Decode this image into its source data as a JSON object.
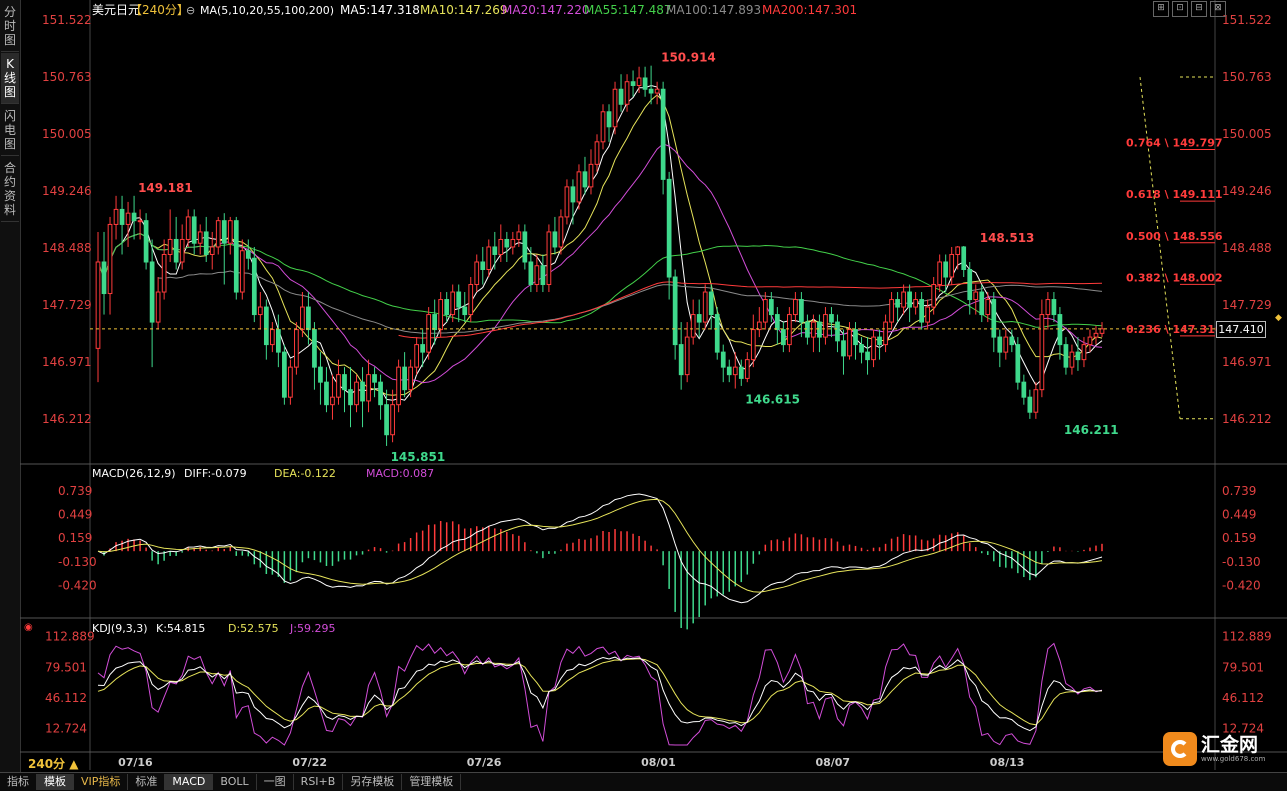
{
  "app": {
    "left_tabs": [
      "分时图",
      "K线图",
      "闪电图",
      "合约资料"
    ],
    "active_left_tab": 1,
    "window_buttons": [
      "⊞",
      "⊡",
      "⊟",
      "⊠"
    ],
    "bottom_tabs": [
      "指标",
      "模板",
      "VIP指标",
      "标准",
      "MACD",
      "BOLL",
      "一图",
      "RSI+B",
      "另存模板",
      "管理模板"
    ],
    "active_bottom_tabs": [
      1,
      4
    ],
    "vip_tab": 2,
    "period_label": "240分 ▲",
    "logo_text": "汇金网",
    "logo_url": "www.gold678.com",
    "current_price_tag": "147.410"
  },
  "chart_data": [
    {
      "type": "candlestick",
      "instrument": "美元日元",
      "period": "【240分】",
      "ma_legend": {
        "header": "MA(5,10,20,55,100,200)",
        "items": [
          {
            "label": "MA5:147.318",
            "color": "#ffffff"
          },
          {
            "label": "MA10:147.269",
            "color": "#e6e35a"
          },
          {
            "label": "MA20:147.220",
            "color": "#d24dd8"
          },
          {
            "label": "MA55:147.487",
            "color": "#43d04a"
          },
          {
            "label": "MA100:147.893",
            "color": "#8a8a8a"
          },
          {
            "label": "MA200:147.301",
            "color": "#ff3b3b"
          }
        ]
      },
      "y_ticks": [
        "151.522",
        "150.763",
        "150.005",
        "149.246",
        "148.488",
        "147.729",
        "146.971",
        "146.212"
      ],
      "ylim": [
        145.85,
        151.522
      ],
      "x_ticks": [
        {
          "label": "07/16",
          "bar": 6
        },
        {
          "label": "07/22",
          "bar": 35
        },
        {
          "label": "07/26",
          "bar": 64
        },
        {
          "label": "08/01",
          "bar": 93
        },
        {
          "label": "08/07",
          "bar": 122
        },
        {
          "label": "08/13",
          "bar": 151
        }
      ],
      "annotations": [
        {
          "text": "149.181",
          "bar": 6,
          "value": 149.181,
          "kind": "high"
        },
        {
          "text": "145.851",
          "bar": 48,
          "value": 145.851,
          "kind": "low"
        },
        {
          "text": "150.914",
          "bar": 93,
          "value": 150.914,
          "kind": "high"
        },
        {
          "text": "146.615",
          "bar": 107,
          "value": 146.615,
          "kind": "low"
        },
        {
          "text": "148.513",
          "bar": 146,
          "value": 148.513,
          "kind": "high"
        },
        {
          "text": "146.211",
          "bar": 160,
          "value": 146.211,
          "kind": "low"
        }
      ],
      "fibonacci": [
        {
          "label": "0.764 \\ 149.797",
          "value": 149.797
        },
        {
          "label": "0.618 \\ 149.111",
          "value": 149.111
        },
        {
          "label": "0.500 \\ 148.556",
          "value": 148.556
        },
        {
          "label": "0.382 \\ 148.002",
          "value": 148.002
        },
        {
          "label": "0.236 \\ 147.316",
          "value": 147.316
        }
      ],
      "fib_range": {
        "top": 150.763,
        "bottom": 146.212
      },
      "current_price": 147.41,
      "candles": [
        [
          147.15,
          148.3,
          148.7,
          146.7
        ],
        [
          148.3,
          147.88,
          148.7,
          147.6
        ],
        [
          147.88,
          148.8,
          148.9,
          147.6
        ],
        [
          148.8,
          149.0,
          149.181,
          148.6
        ],
        [
          149.0,
          148.8,
          149.181,
          148.4
        ],
        [
          148.8,
          148.95,
          149.1,
          148.5
        ],
        [
          148.95,
          148.85,
          149.181,
          148.6
        ],
        [
          148.85,
          148.85,
          149.0,
          148.6
        ],
        [
          148.85,
          148.3,
          148.95,
          148.2
        ],
        [
          148.3,
          147.5,
          148.6,
          146.9
        ],
        [
          147.5,
          147.9,
          148.1,
          147.4
        ],
        [
          147.9,
          148.4,
          148.6,
          147.8
        ],
        [
          148.4,
          148.6,
          149.0,
          148.3
        ],
        [
          148.6,
          148.3,
          148.9,
          148.2
        ],
        [
          148.3,
          148.6,
          148.8,
          148.2
        ],
        [
          148.6,
          148.9,
          149.0,
          148.5
        ],
        [
          148.9,
          148.55,
          149.0,
          148.4
        ],
        [
          148.55,
          148.7,
          148.8,
          148.4
        ],
        [
          148.7,
          148.4,
          148.9,
          148.3
        ],
        [
          148.4,
          148.5,
          148.7,
          148.2
        ],
        [
          148.5,
          148.85,
          148.9,
          148.4
        ],
        [
          148.85,
          148.55,
          148.95,
          148.0
        ],
        [
          148.55,
          148.85,
          148.9,
          148.4
        ],
        [
          148.85,
          147.9,
          148.9,
          147.8
        ],
        [
          147.9,
          148.45,
          148.6,
          147.8
        ],
        [
          148.45,
          148.35,
          148.6,
          148.2
        ],
        [
          148.35,
          147.6,
          148.5,
          147.5
        ],
        [
          147.6,
          147.7,
          147.9,
          147.4
        ],
        [
          147.7,
          147.2,
          147.8,
          147.0
        ],
        [
          147.2,
          147.4,
          147.5,
          147.1
        ],
        [
          147.4,
          147.1,
          147.6,
          146.9
        ],
        [
          147.1,
          146.5,
          147.2,
          146.4
        ],
        [
          146.5,
          146.9,
          147.0,
          146.4
        ],
        [
          146.9,
          147.4,
          147.5,
          146.8
        ],
        [
          147.4,
          147.7,
          147.9,
          147.3
        ],
        [
          147.7,
          147.4,
          147.9,
          147.2
        ],
        [
          147.4,
          146.9,
          147.5,
          146.6
        ],
        [
          146.9,
          146.7,
          147.1,
          146.4
        ],
        [
          146.7,
          146.4,
          146.9,
          146.3
        ],
        [
          146.4,
          146.5,
          146.8,
          146.2
        ],
        [
          146.5,
          146.8,
          147.0,
          146.4
        ],
        [
          146.8,
          146.6,
          146.9,
          146.3
        ],
        [
          146.6,
          146.4,
          146.9,
          146.1
        ],
        [
          146.4,
          146.7,
          146.8,
          146.3
        ],
        [
          146.7,
          146.45,
          146.9,
          146.1
        ],
        [
          146.45,
          146.8,
          147.0,
          146.3
        ],
        [
          146.8,
          146.7,
          146.9,
          146.5
        ],
        [
          146.7,
          146.4,
          146.8,
          146.2
        ],
        [
          146.4,
          146.0,
          146.6,
          145.851
        ],
        [
          146.0,
          146.4,
          146.6,
          145.9
        ],
        [
          146.4,
          146.9,
          147.0,
          146.3
        ],
        [
          146.9,
          146.6,
          147.1,
          146.5
        ],
        [
          146.6,
          146.9,
          147.0,
          146.5
        ],
        [
          146.9,
          147.2,
          147.3,
          146.8
        ],
        [
          147.2,
          147.1,
          147.4,
          146.9
        ],
        [
          147.1,
          147.6,
          147.7,
          147.0
        ],
        [
          147.6,
          147.4,
          147.8,
          147.2
        ],
        [
          147.4,
          147.8,
          147.9,
          147.3
        ],
        [
          147.8,
          147.6,
          147.9,
          147.5
        ],
        [
          147.6,
          147.9,
          148.0,
          147.5
        ],
        [
          147.9,
          147.7,
          148.0,
          147.5
        ],
        [
          147.7,
          147.6,
          147.9,
          147.5
        ],
        [
          147.6,
          148.0,
          148.1,
          147.5
        ],
        [
          148.0,
          148.3,
          148.4,
          147.9
        ],
        [
          148.3,
          148.2,
          148.5,
          148.0
        ],
        [
          148.2,
          148.5,
          148.6,
          148.1
        ],
        [
          148.5,
          148.4,
          148.7,
          148.2
        ],
        [
          148.4,
          148.6,
          148.8,
          148.3
        ],
        [
          148.6,
          148.5,
          148.7,
          148.3
        ],
        [
          148.5,
          148.6,
          148.7,
          148.4
        ],
        [
          148.6,
          148.7,
          148.8,
          148.5
        ],
        [
          148.7,
          148.3,
          148.8,
          148.2
        ],
        [
          148.3,
          148.0,
          148.5,
          147.9
        ],
        [
          148.0,
          148.25,
          148.4,
          147.9
        ],
        [
          148.25,
          148.0,
          148.4,
          147.9
        ],
        [
          148.0,
          148.7,
          148.8,
          147.9
        ],
        [
          148.7,
          148.5,
          148.9,
          148.4
        ],
        [
          148.5,
          148.9,
          149.0,
          148.4
        ],
        [
          148.9,
          149.3,
          149.4,
          148.8
        ],
        [
          149.3,
          149.1,
          149.4,
          148.8
        ],
        [
          149.1,
          149.5,
          149.6,
          149.0
        ],
        [
          149.5,
          149.3,
          149.7,
          149.2
        ],
        [
          149.3,
          149.6,
          149.8,
          149.2
        ],
        [
          149.6,
          149.9,
          150.0,
          149.5
        ],
        [
          149.9,
          150.3,
          150.4,
          149.8
        ],
        [
          150.3,
          150.1,
          150.4,
          149.9
        ],
        [
          150.1,
          150.6,
          150.7,
          150.0
        ],
        [
          150.6,
          150.4,
          150.8,
          150.3
        ],
        [
          150.4,
          150.7,
          150.8,
          150.3
        ],
        [
          150.7,
          150.65,
          150.85,
          150.5
        ],
        [
          150.65,
          150.75,
          150.9,
          150.55
        ],
        [
          150.75,
          150.6,
          150.9,
          150.5
        ],
        [
          150.6,
          150.55,
          150.914,
          150.4
        ],
        [
          150.55,
          150.6,
          150.7,
          150.4
        ],
        [
          150.6,
          149.4,
          150.7,
          149.2
        ],
        [
          149.4,
          148.1,
          149.5,
          147.8
        ],
        [
          148.1,
          147.2,
          148.2,
          147.0
        ],
        [
          147.2,
          146.8,
          147.5,
          146.6
        ],
        [
          146.8,
          147.3,
          147.5,
          146.7
        ],
        [
          147.3,
          147.6,
          147.8,
          147.2
        ],
        [
          147.6,
          147.5,
          147.8,
          147.3
        ],
        [
          147.5,
          147.9,
          148.0,
          147.4
        ],
        [
          147.9,
          147.6,
          148.0,
          147.4
        ],
        [
          147.6,
          147.1,
          147.7,
          147.0
        ],
        [
          147.1,
          146.9,
          147.2,
          146.7
        ],
        [
          146.9,
          146.8,
          147.0,
          146.7
        ],
        [
          146.8,
          146.9,
          147.1,
          146.615
        ],
        [
          146.9,
          146.75,
          147.0,
          146.65
        ],
        [
          146.75,
          147.0,
          147.1,
          146.7
        ],
        [
          147.0,
          147.4,
          147.6,
          146.9
        ],
        [
          147.4,
          147.5,
          147.7,
          147.3
        ],
        [
          147.5,
          147.8,
          147.9,
          147.4
        ],
        [
          147.8,
          147.6,
          147.9,
          147.5
        ],
        [
          147.6,
          147.4,
          147.7,
          147.2
        ],
        [
          147.4,
          147.2,
          147.5,
          147.1
        ],
        [
          147.2,
          147.6,
          147.7,
          147.1
        ],
        [
          147.6,
          147.8,
          147.9,
          147.5
        ],
        [
          147.8,
          147.5,
          147.9,
          147.3
        ],
        [
          147.5,
          147.3,
          147.6,
          147.2
        ],
        [
          147.3,
          147.5,
          147.6,
          147.1
        ],
        [
          147.5,
          147.3,
          147.6,
          147.1
        ],
        [
          147.3,
          147.6,
          147.7,
          147.2
        ],
        [
          147.6,
          147.5,
          147.7,
          147.3
        ],
        [
          147.5,
          147.25,
          147.6,
          147.1
        ],
        [
          147.25,
          147.05,
          147.4,
          146.8
        ],
        [
          147.05,
          147.4,
          147.5,
          147.0
        ],
        [
          147.4,
          147.2,
          147.5,
          147.0
        ],
        [
          147.2,
          147.1,
          147.3,
          146.95
        ],
        [
          147.1,
          147.0,
          147.3,
          146.8
        ],
        [
          147.0,
          147.3,
          147.4,
          146.9
        ],
        [
          147.3,
          147.2,
          147.4,
          147.0
        ],
        [
          147.2,
          147.5,
          147.6,
          147.1
        ],
        [
          147.5,
          147.8,
          147.9,
          147.4
        ],
        [
          147.8,
          147.7,
          147.9,
          147.5
        ],
        [
          147.7,
          147.9,
          148.0,
          147.6
        ],
        [
          147.9,
          147.7,
          148.0,
          147.5
        ],
        [
          147.7,
          147.8,
          147.9,
          147.6
        ],
        [
          147.8,
          147.5,
          147.9,
          147.4
        ],
        [
          147.5,
          147.7,
          147.8,
          147.4
        ],
        [
          147.7,
          148.0,
          148.1,
          147.6
        ],
        [
          148.0,
          148.3,
          148.4,
          147.9
        ],
        [
          148.3,
          148.1,
          148.4,
          147.9
        ],
        [
          148.1,
          148.4,
          148.5,
          148.0
        ],
        [
          148.4,
          148.5,
          148.513,
          148.2
        ],
        [
          148.5,
          148.2,
          148.513,
          148.1
        ],
        [
          148.2,
          147.8,
          148.3,
          147.6
        ],
        [
          147.8,
          147.9,
          148.0,
          147.6
        ],
        [
          147.9,
          147.6,
          148.0,
          147.5
        ],
        [
          147.6,
          147.8,
          147.9,
          147.5
        ],
        [
          147.8,
          147.3,
          147.9,
          147.1
        ],
        [
          147.3,
          147.1,
          147.4,
          146.9
        ],
        [
          147.1,
          147.3,
          147.4,
          147.0
        ],
        [
          147.3,
          147.2,
          147.4,
          147.1
        ],
        [
          147.2,
          146.7,
          147.3,
          146.6
        ],
        [
          146.7,
          146.5,
          146.8,
          146.4
        ],
        [
          146.5,
          146.3,
          146.6,
          146.211
        ],
        [
          146.3,
          146.6,
          146.7,
          146.211
        ],
        [
          146.6,
          147.6,
          147.8,
          146.5
        ],
        [
          147.6,
          147.8,
          147.9,
          147.4
        ],
        [
          147.8,
          147.6,
          147.9,
          147.5
        ],
        [
          147.6,
          147.2,
          147.7,
          147.0
        ],
        [
          147.2,
          146.9,
          147.3,
          146.8
        ],
        [
          146.9,
          147.1,
          147.2,
          146.8
        ],
        [
          147.1,
          147.0,
          147.3,
          146.85
        ],
        [
          147.0,
          147.2,
          147.3,
          146.9
        ],
        [
          147.2,
          147.3,
          147.4,
          147.1
        ],
        [
          147.3,
          147.35,
          147.45,
          147.2
        ],
        [
          147.35,
          147.41,
          147.5,
          147.3
        ]
      ]
    },
    {
      "type": "macd",
      "title": "MACD(26,12,9)",
      "legend": [
        {
          "label": "DIFF:-0.079",
          "color": "#ffffff"
        },
        {
          "label": "DEA:-0.122",
          "color": "#e6e35a"
        },
        {
          "label": "MACD:0.087",
          "color": "#d24dd8"
        }
      ],
      "y_ticks": [
        "0.739",
        "0.449",
        "0.159",
        "-0.130",
        "-0.420"
      ],
      "ylim": [
        -0.6,
        0.85
      ]
    },
    {
      "type": "kdj",
      "title": "KDJ(9,3,3)",
      "legend": [
        {
          "label": "K:54.815",
          "color": "#ffffff"
        },
        {
          "label": "D:52.575",
          "color": "#e6e35a"
        },
        {
          "label": "J:59.295",
          "color": "#d24dd8"
        }
      ],
      "y_ticks": [
        "112.889",
        "79.501",
        "46.112",
        "12.724"
      ],
      "ylim": [
        -5,
        120
      ]
    }
  ]
}
